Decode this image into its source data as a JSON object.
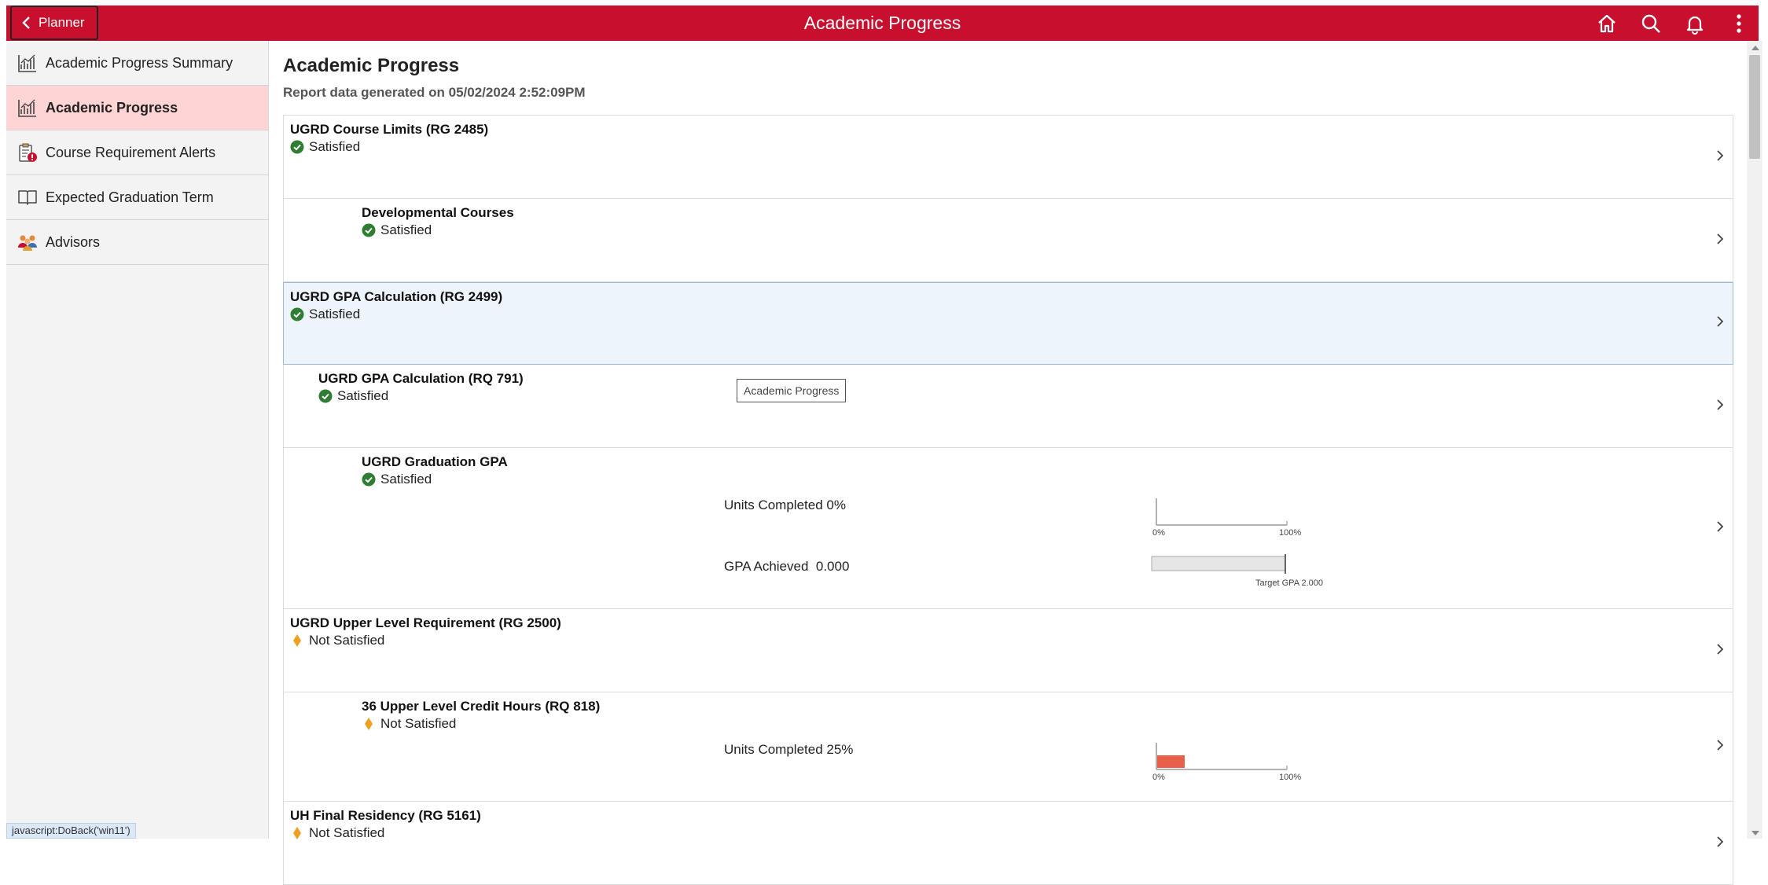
{
  "header": {
    "back_label": "Planner",
    "title": "Academic Progress"
  },
  "sidebar": {
    "items": [
      {
        "label": "Academic Progress Summary"
      },
      {
        "label": "Academic Progress"
      },
      {
        "label": "Course Requirement Alerts"
      },
      {
        "label": "Expected Graduation Term"
      },
      {
        "label": "Advisors"
      }
    ]
  },
  "main": {
    "title": "Academic Progress",
    "report_line": "Report data generated on 05/02/2024 2:52:09PM",
    "rows": [
      {
        "title": "UGRD Course Limits (RG 2485)",
        "status": "Satisfied"
      },
      {
        "title": "Developmental Courses",
        "status": "Satisfied"
      },
      {
        "title": "UGRD GPA Calculation (RG 2499)",
        "status": "Satisfied"
      },
      {
        "title": "UGRD GPA Calculation (RQ 791)",
        "status": "Satisfied"
      },
      {
        "title": "UGRD Graduation GPA",
        "status": "Satisfied",
        "units_label": "Units Completed 0%",
        "units_percent": 0,
        "gpa_label": "GPA Achieved  0.000",
        "gpa_value": 0.0,
        "gpa_target_label": "Target GPA 2.000"
      },
      {
        "title": "UGRD Upper Level Requirement (RG 2500)",
        "status": "Not Satisfied"
      },
      {
        "title": "36 Upper Level Credit Hours (RQ 818)",
        "status": "Not Satisfied",
        "units_label": "Units Completed 25%",
        "units_percent": 25
      },
      {
        "title": "UH Final Residency (RG 5161)",
        "status": "Not Satisfied"
      }
    ],
    "scale_min": "0%",
    "scale_max": "100%",
    "tooltip": "Academic Progress"
  },
  "status_bar": "javascript:DoBack('win11')",
  "colors": {
    "brand": "#c8102e",
    "satisfied": "#2e7d32",
    "not_satisfied": "#f0a020",
    "progress_fill": "#e8604c"
  }
}
